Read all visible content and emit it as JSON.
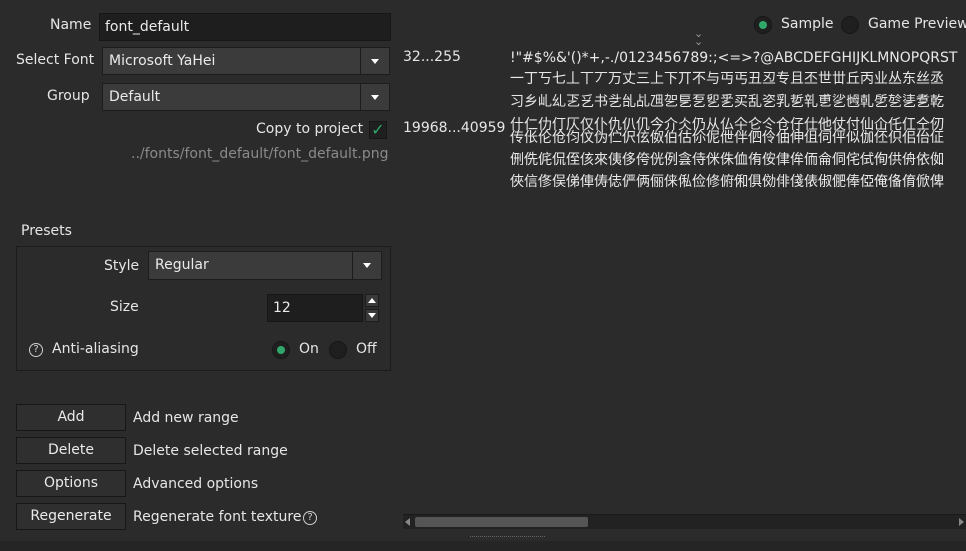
{
  "font": {
    "name_label": "Name",
    "name_value": "font_default",
    "select_font_label": "Select Font",
    "select_font_value": "Microsoft YaHei",
    "group_label": "Group",
    "group_value": "Default",
    "copy_label": "Copy to project",
    "copy_checked": true,
    "path": "../fonts/font_default/font_default.png"
  },
  "presets": {
    "title": "Presets",
    "style_label": "Style",
    "style_value": "Regular",
    "size_label": "Size",
    "size_value": "12",
    "aa_label": "Anti-aliasing",
    "aa_on": "On",
    "aa_off": "Off",
    "aa_selected": "On"
  },
  "actions": [
    {
      "button": "Add",
      "desc": "Add new range"
    },
    {
      "button": "Delete",
      "desc": "Delete selected range"
    },
    {
      "button": "Options",
      "desc": "Advanced options"
    },
    {
      "button": "Regenerate",
      "desc": "Regenerate font texture"
    }
  ],
  "preview": {
    "sample_label": "Sample",
    "game_label": "Game Preview",
    "selected": "Sample",
    "ranges": [
      {
        "range": "32...255",
        "lines": [
          "!\"#$%&'()*+,-./0123456789:;<=>?@ABCDEFGHIJKLMNOPQRST"
        ]
      },
      {
        "range": "19968...40959",
        "lines": [
          "一丁丂七丄丅丆万丈三上下丌不与丏丐丑丒专且丕世丗丘丙业丛东丝丞",
          "习乡乢乣乤乥书乧乨乩乪乫乬乭乮乯买乱乲乳乴乵乶乷乸乹乺乻乼乽乾",
          "什仁仂仃仄仅仆仇仈仉今介仌仍从仏仐仑仒仓仔仕他仗付仙仚仛仜仝仞",
          "传伥伦伧伨伩伪伫伬伭伮伯估伱伲伳伴伵伶伷伸伹伺伻似伽伾伿佀佁佂",
          "侀侁侂侃侄侅來侇侈侉侊例侌侍侎侏侐侑侒侓侔侕侖侗侘侙侚供侜依侞",
          "俠信俢俣俤俥俦俧俨俩俪俫俬俭修俯俰俱俲俳俴俵俶俷俸俹俺俻俼俽俾"
        ]
      }
    ]
  }
}
